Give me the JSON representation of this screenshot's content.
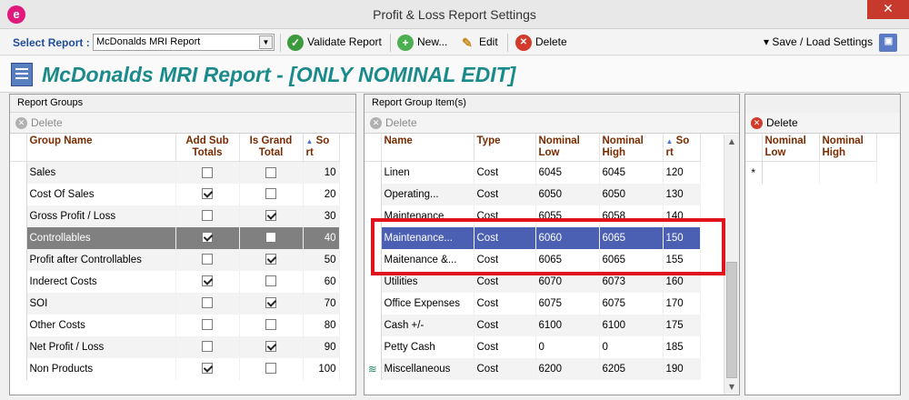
{
  "window": {
    "title": "Profit & Loss Report Settings",
    "app_icon_letter": "e",
    "close_label": "✕"
  },
  "toolbar": {
    "select_label": "Select Report :",
    "selected_report": "McDonalds MRI Report",
    "validate_label": "Validate Report",
    "new_label": "New...",
    "edit_label": "Edit",
    "delete_label": "Delete",
    "save_load_label": "▾ Save / Load Settings"
  },
  "header": {
    "title": "McDonalds MRI Report - [ONLY NOMINAL EDIT]"
  },
  "groups_panel": {
    "caption": "Report Groups",
    "delete_label": "Delete",
    "columns": {
      "name": "Group Name",
      "add_sub": "Add Sub Totals",
      "grand": "Is Grand Total",
      "sort": "So rt"
    },
    "rows": [
      {
        "name": "Sales",
        "add_sub": false,
        "grand": false,
        "sort": "10"
      },
      {
        "name": "Cost Of Sales",
        "add_sub": true,
        "grand": false,
        "sort": "20"
      },
      {
        "name": "Gross Profit / Loss",
        "add_sub": false,
        "grand": true,
        "sort": "30"
      },
      {
        "name": "Controllables",
        "add_sub": true,
        "grand": false,
        "sort": "40"
      },
      {
        "name": "Profit after Controllables",
        "add_sub": false,
        "grand": true,
        "sort": "50"
      },
      {
        "name": "Inderect Costs",
        "add_sub": true,
        "grand": false,
        "sort": "60"
      },
      {
        "name": "SOI",
        "add_sub": false,
        "grand": true,
        "sort": "70"
      },
      {
        "name": "Other Costs",
        "add_sub": false,
        "grand": false,
        "sort": "80"
      },
      {
        "name": "Net Profit / Loss",
        "add_sub": false,
        "grand": true,
        "sort": "90"
      },
      {
        "name": "Non Products",
        "add_sub": true,
        "grand": false,
        "sort": "100"
      }
    ]
  },
  "items_panel": {
    "caption": "Report Group Item(s)",
    "delete_label": "Delete",
    "columns": {
      "name": "Name",
      "type": "Type",
      "low": "Nominal Low",
      "high": "Nominal High",
      "sort": "So rt"
    },
    "rows": [
      {
        "name": "Linen",
        "type": "Cost",
        "low": "6045",
        "high": "6045",
        "sort": "120"
      },
      {
        "name": "Operating...",
        "type": "Cost",
        "low": "6050",
        "high": "6050",
        "sort": "130"
      },
      {
        "name": "Maintenance",
        "type": "Cost",
        "low": "6055",
        "high": "6058",
        "sort": "140"
      },
      {
        "name": "Maintenance...",
        "type": "Cost",
        "low": "6060",
        "high": "6065",
        "sort": "150"
      },
      {
        "name": "Maitenance &...",
        "type": "Cost",
        "low": "6065",
        "high": "6065",
        "sort": "155"
      },
      {
        "name": "Utilities",
        "type": "Cost",
        "low": "6070",
        "high": "6073",
        "sort": "160"
      },
      {
        "name": "Office Expenses",
        "type": "Cost",
        "low": "6075",
        "high": "6075",
        "sort": "170"
      },
      {
        "name": "Cash +/-",
        "type": "Cost",
        "low": "6100",
        "high": "6100",
        "sort": "175"
      },
      {
        "name": "Petty Cash",
        "type": "Cost",
        "low": "0",
        "high": "0",
        "sort": "185"
      },
      {
        "name": "Miscellaneous",
        "type": "Cost",
        "low": "6200",
        "high": "6205",
        "sort": "190"
      }
    ]
  },
  "nominal_panel": {
    "delete_label": "Delete",
    "columns": {
      "low": "Nominal Low",
      "high": "Nominal High"
    },
    "new_row_marker": "*"
  },
  "colors": {
    "accent_title": "#1a8a8a",
    "selected_grey": "#808080",
    "selected_blue": "#4b5fb3",
    "highlight_box": "#e0141c",
    "header_text": "#7a2b00"
  },
  "icons": [
    "app-e-icon",
    "check-icon",
    "plus-icon",
    "pencil-icon",
    "delete-icon",
    "save-disk-icon",
    "report-doc-icon",
    "sort-arrow-icon",
    "row-pointer-icon",
    "stack-icon"
  ]
}
